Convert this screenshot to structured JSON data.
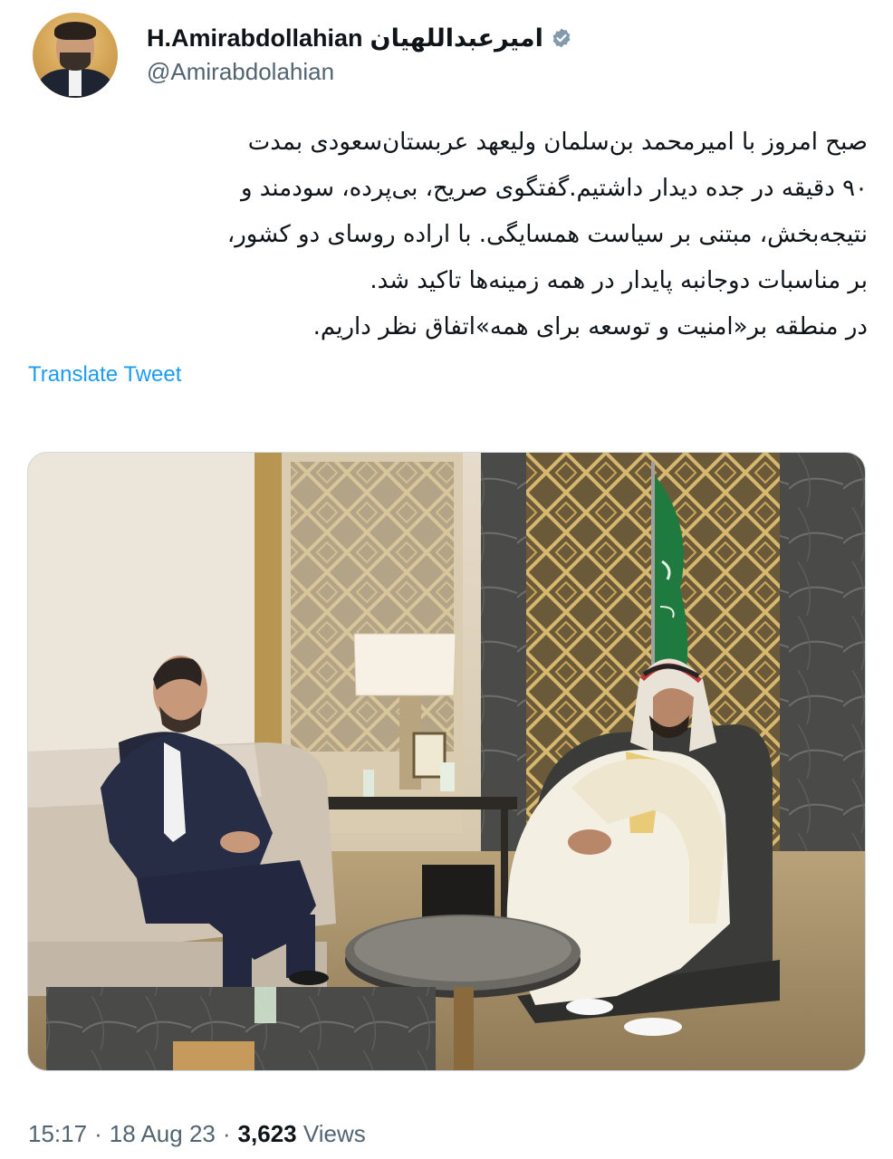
{
  "author": {
    "display_name_latin": "H.Amirabdollahian",
    "display_name_persian": "امیرعبداللهیان",
    "handle": "@Amirabdolahian",
    "avatar_icon": "profile-photo"
  },
  "tweet": {
    "lines": [
      "صبح امروز با امیرمحمد بن‌سلمان ولیعهد عربستان‌سعودی بمدت",
      "۹۰ دقیقه در جده دیدار داشتیم.گفتگوی صریح، بی‌پرده، سودمند و",
      "نتیجه‌بخش، مبتنی بر سیاست همسایگی. با اراده روسای دو کشور،",
      "بر مناسبات دوجانبه پایدار در همه زمینه‌ها تاکید شد.",
      "در منطقه بر«امنیت و توسعه برای همه»اتفاق نظر داریم."
    ],
    "translate_label": "Translate Tweet",
    "media_icon": "meeting-photo"
  },
  "meta": {
    "time": "15:17",
    "date": "18 Aug 23",
    "views_count": "3,623",
    "views_label": "Views",
    "separator": "·"
  },
  "colors": {
    "link": "#1d9bf0",
    "verified_badge": "#829aab",
    "secondary_text": "#536471"
  }
}
